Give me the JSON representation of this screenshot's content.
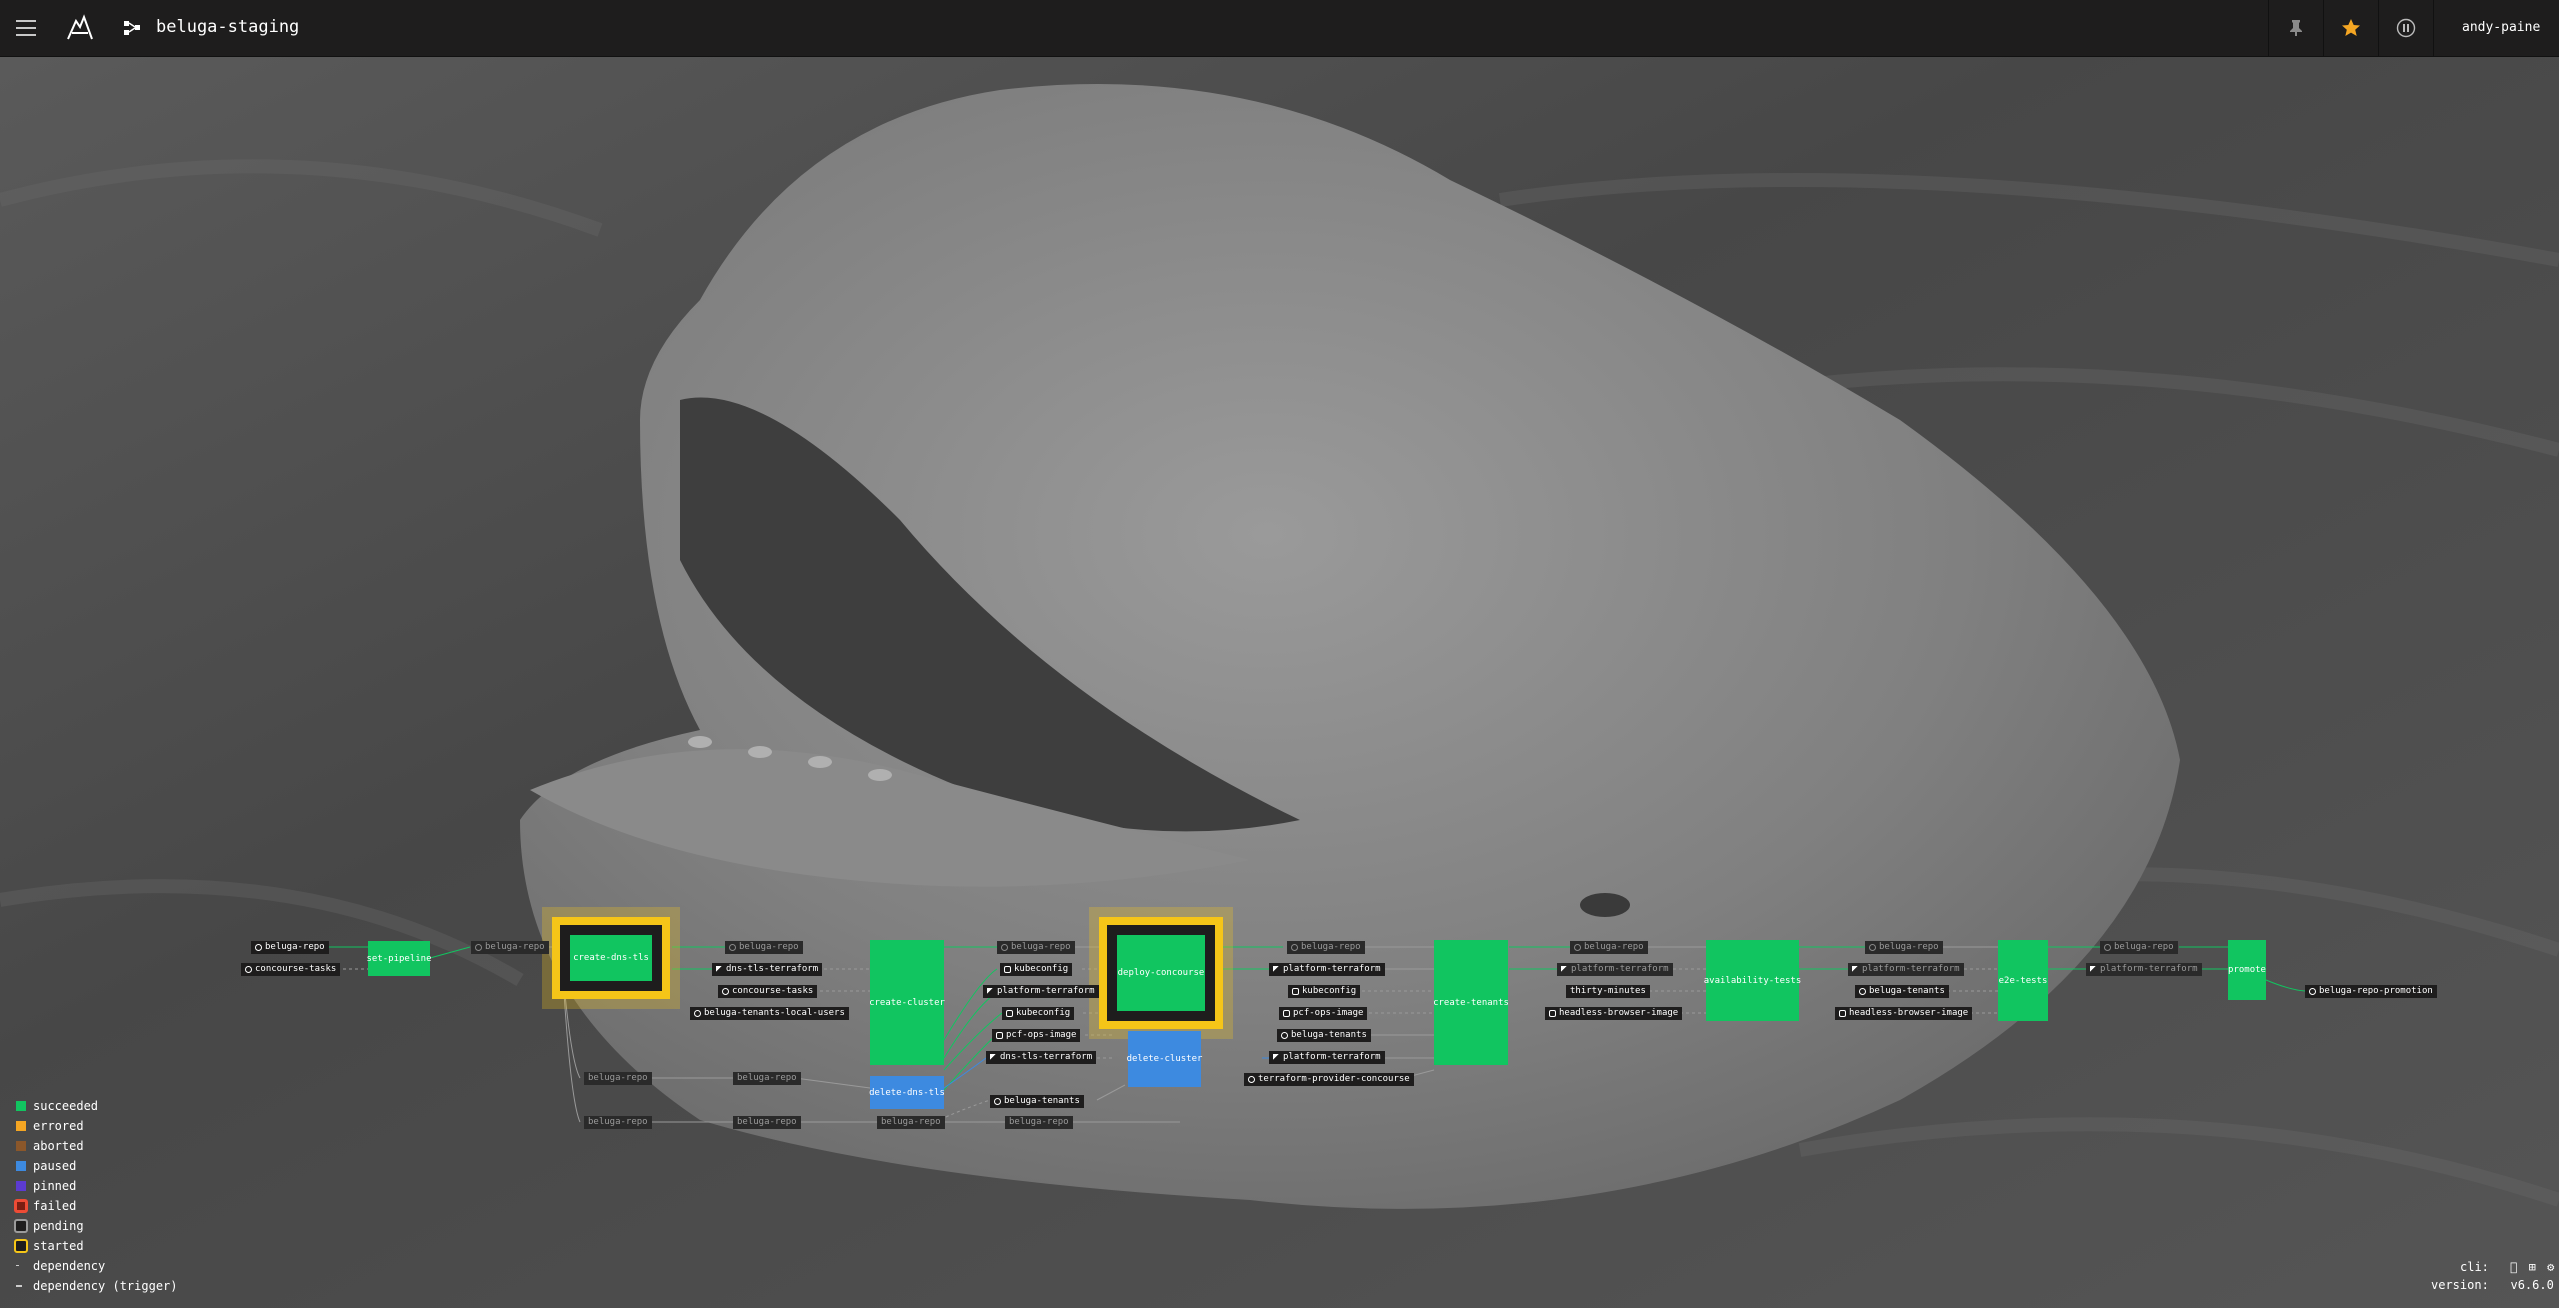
{
  "header": {
    "pipeline_name": "beluga-staging",
    "user": "andy-paine",
    "icons": {
      "menu": "hamburger-icon",
      "logo": "concourse-logo",
      "pipeline": "pipeline-icon",
      "pin": "pin-icon",
      "favorite": "star-icon",
      "pause": "pause-icon"
    }
  },
  "colors": {
    "succeeded": "#11c560",
    "errored": "#f5a623",
    "aborted": "#8b572a",
    "paused": "#3d8ae0",
    "pinned": "#5c3bd1",
    "failed": "#ed4b35",
    "pending": "#9b9b9b",
    "started": "#f5c518",
    "topbar": "#1e1d1d"
  },
  "resources": {
    "r1": "beluga-repo",
    "r2": "concourse-tasks",
    "r3": "beluga-repo",
    "r4": "beluga-repo",
    "r5": "dns-tls-terraform",
    "r6": "concourse-tasks",
    "r7": "beluga-tenants-local-users",
    "r8": "beluga-repo",
    "r9": "beluga-repo",
    "r10": "beluga-repo",
    "r11": "kubeconfig",
    "r12": "platform-terraform",
    "r13": "kubeconfig",
    "r14": "pcf-ops-image",
    "r15": "dns-tls-terraform",
    "r16": "beluga-tenants",
    "r17": "beluga-repo",
    "r18": "beluga-repo",
    "r19": "beluga-repo",
    "r20": "platform-terraform",
    "r21": "kubeconfig",
    "r22": "pcf-ops-image",
    "r23": "beluga-tenants",
    "r24": "platform-terraform",
    "r25": "terraform-provider-concourse",
    "r26": "beluga-repo",
    "r27": "platform-terraform",
    "r28": "thirty-minutes",
    "r29": "headless-browser-image",
    "r30": "beluga-repo",
    "r31": "platform-terraform",
    "r32": "beluga-tenants",
    "r33": "headless-browser-image",
    "r34": "beluga-repo",
    "r35": "platform-terraform",
    "r36": "beluga-repo-promotion"
  },
  "jobs": {
    "j1": "set-pipeline",
    "j2": "create-dns-tls",
    "j3": "create-cluster",
    "j4": "delete-dns-tls",
    "j5": "deploy-concourse",
    "j6": "delete-cluster",
    "j7": "create-tenants",
    "j8": "availability-tests",
    "j9": "e2e-tests",
    "j10": "promote"
  },
  "legend": {
    "succeeded": "succeeded",
    "errored": "errored",
    "aborted": "aborted",
    "paused": "paused",
    "pinned": "pinned",
    "failed": "failed",
    "pending": "pending",
    "started": "started",
    "dependency": "dependency",
    "dependency_trigger": "dependency (trigger)"
  },
  "footer": {
    "cli_label": "cli:",
    "version_label": "version:",
    "version": "v6.6.0",
    "cli_icons": [
      "apple-icon",
      "windows-icon",
      "linux-icon"
    ]
  }
}
